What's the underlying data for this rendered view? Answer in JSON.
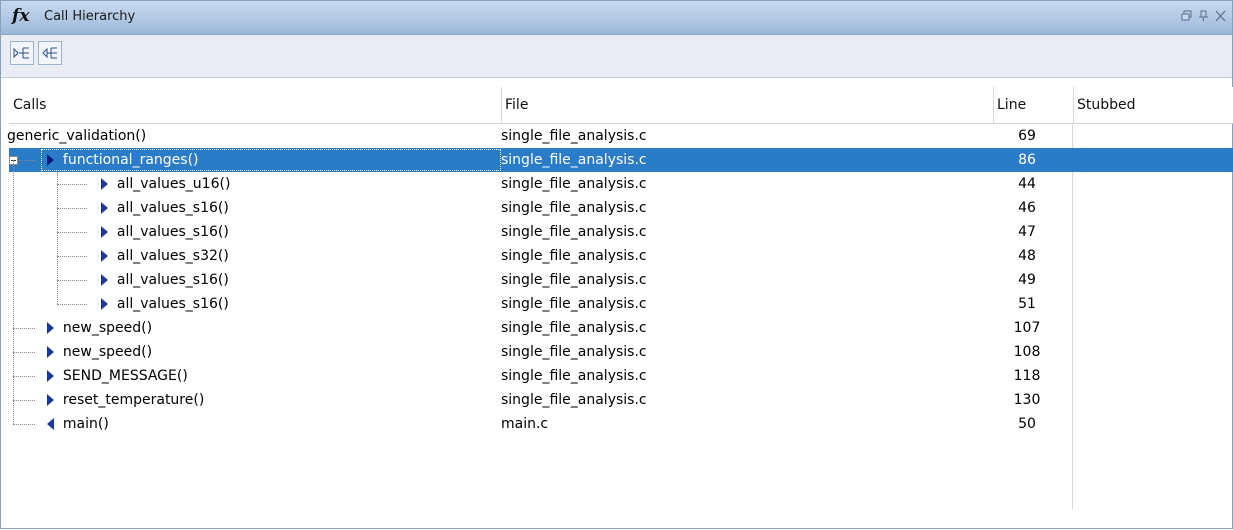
{
  "window": {
    "title": "Call Hierarchy",
    "title_icon": "fx",
    "controls": [
      "restore-icon",
      "pin-icon",
      "close-icon"
    ]
  },
  "toolbar": {
    "buttons": [
      {
        "name": "show-callees-button",
        "icon": "callees-icon"
      },
      {
        "name": "show-callers-button",
        "icon": "callers-icon"
      }
    ]
  },
  "table": {
    "headers": {
      "calls": "Calls",
      "file": "File",
      "line": "Line",
      "stubbed": "Stubbed"
    },
    "rows": [
      {
        "call": "generic_validation()",
        "file": "single_file_analysis.c",
        "line": "69",
        "stubbed": "",
        "indent": 0,
        "arrow": "none",
        "selected": false
      },
      {
        "call": "functional_ranges()",
        "file": "single_file_analysis.c",
        "line": "86",
        "stubbed": "",
        "indent": 1,
        "arrow": "right",
        "selected": true,
        "expanded": true
      },
      {
        "call": "all_values_u16()",
        "file": "single_file_analysis.c",
        "line": "44",
        "stubbed": "",
        "indent": 2,
        "arrow": "right",
        "selected": false
      },
      {
        "call": "all_values_s16()",
        "file": "single_file_analysis.c",
        "line": "46",
        "stubbed": "",
        "indent": 2,
        "arrow": "right",
        "selected": false
      },
      {
        "call": "all_values_s16()",
        "file": "single_file_analysis.c",
        "line": "47",
        "stubbed": "",
        "indent": 2,
        "arrow": "right",
        "selected": false
      },
      {
        "call": "all_values_s32()",
        "file": "single_file_analysis.c",
        "line": "48",
        "stubbed": "",
        "indent": 2,
        "arrow": "right",
        "selected": false
      },
      {
        "call": "all_values_s16()",
        "file": "single_file_analysis.c",
        "line": "49",
        "stubbed": "",
        "indent": 2,
        "arrow": "right",
        "selected": false
      },
      {
        "call": "all_values_s16()",
        "file": "single_file_analysis.c",
        "line": "51",
        "stubbed": "",
        "indent": 2,
        "arrow": "right",
        "selected": false
      },
      {
        "call": "new_speed()",
        "file": "single_file_analysis.c",
        "line": "107",
        "stubbed": "",
        "indent": 1,
        "arrow": "right",
        "selected": false
      },
      {
        "call": "new_speed()",
        "file": "single_file_analysis.c",
        "line": "108",
        "stubbed": "",
        "indent": 1,
        "arrow": "right",
        "selected": false
      },
      {
        "call": "SEND_MESSAGE()",
        "file": "single_file_analysis.c",
        "line": "118",
        "stubbed": "",
        "indent": 1,
        "arrow": "right",
        "selected": false
      },
      {
        "call": "reset_temperature()",
        "file": "single_file_analysis.c",
        "line": "130",
        "stubbed": "",
        "indent": 1,
        "arrow": "right",
        "selected": false
      },
      {
        "call": "main()",
        "file": "main.c",
        "line": "50",
        "stubbed": "",
        "indent": 1,
        "arrow": "left",
        "selected": false
      }
    ]
  },
  "colors": {
    "selection": "#2a7cc9",
    "arrow": "#1b3b9c",
    "title_bar_top": "#c8daf0",
    "title_bar_bottom": "#9db8d9"
  }
}
